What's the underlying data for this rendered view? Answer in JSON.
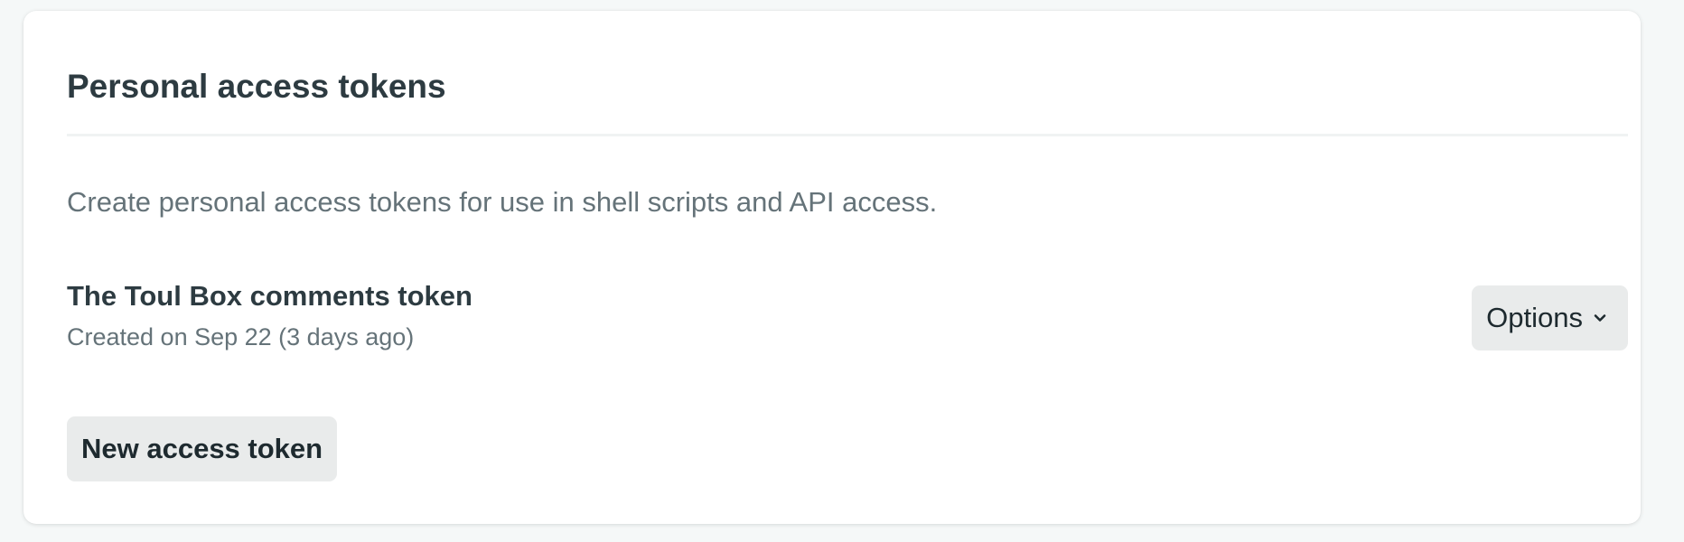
{
  "section": {
    "title": "Personal access tokens",
    "description": "Create personal access tokens for use in shell scripts and API access."
  },
  "tokens": [
    {
      "name": "The Toul Box comments token",
      "created": "Created on Sep 22 (3 days ago)",
      "options_label": "Options",
      "options_icon": "chevron-down-icon"
    }
  ],
  "actions": {
    "new_token_label": "New access token"
  },
  "colors": {
    "background": "#f5f8f8",
    "card": "#ffffff",
    "heading_text": "#2d3b41",
    "muted_text": "#657379",
    "button_bg": "#e9ebeb",
    "button_text": "#1e2a2f"
  }
}
